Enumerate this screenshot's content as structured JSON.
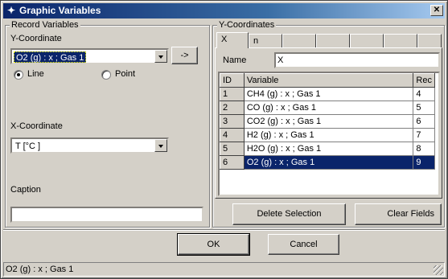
{
  "window": {
    "title": "Graphic Variables",
    "close_label": "✕"
  },
  "record_variables": {
    "group_label": "Record Variables",
    "y_coordinate_label": "Y-Coordinate",
    "y_coordinate_value": "O2 (g) : x ; Gas 1",
    "add_button_label": "->",
    "radio_line_label": "Line",
    "radio_point_label": "Point",
    "selected_mode": "Line",
    "x_coordinate_label": "X-Coordinate",
    "x_coordinate_value": "T [°C ]",
    "caption_label": "Caption",
    "caption_value": ""
  },
  "y_coordinates": {
    "group_label": "Y-Coordinates",
    "tabs": [
      {
        "label": "X",
        "active": true
      },
      {
        "label": "n",
        "active": false
      },
      {
        "label": "",
        "active": false
      },
      {
        "label": "",
        "active": false
      },
      {
        "label": "",
        "active": false
      },
      {
        "label": "",
        "active": false
      },
      {
        "label": "",
        "active": false
      }
    ],
    "name_label": "Name",
    "name_value": "X",
    "columns": [
      "ID",
      "Variable",
      "Rec"
    ],
    "rows": [
      {
        "id": "1",
        "variable": "CH4 (g) : x ; Gas 1",
        "rec": "4",
        "selected": false
      },
      {
        "id": "2",
        "variable": "CO (g) : x ; Gas 1",
        "rec": "5",
        "selected": false
      },
      {
        "id": "3",
        "variable": "CO2 (g) : x ; Gas 1",
        "rec": "6",
        "selected": false
      },
      {
        "id": "4",
        "variable": "H2 (g) : x ; Gas 1",
        "rec": "7",
        "selected": false
      },
      {
        "id": "5",
        "variable": "H2O (g) : x ; Gas 1",
        "rec": "8",
        "selected": false
      },
      {
        "id": "6",
        "variable": "O2 (g) : x ; Gas 1",
        "rec": "9",
        "selected": true
      }
    ],
    "delete_selection_label": "Delete Selection",
    "clear_fields_label": "Clear Fields"
  },
  "footer": {
    "ok_label": "OK",
    "cancel_label": "Cancel"
  },
  "statusbar": {
    "text": "O2 (g) : x ; Gas 1"
  },
  "colors": {
    "selection": "#0a246a",
    "face": "#d4d0c8"
  }
}
